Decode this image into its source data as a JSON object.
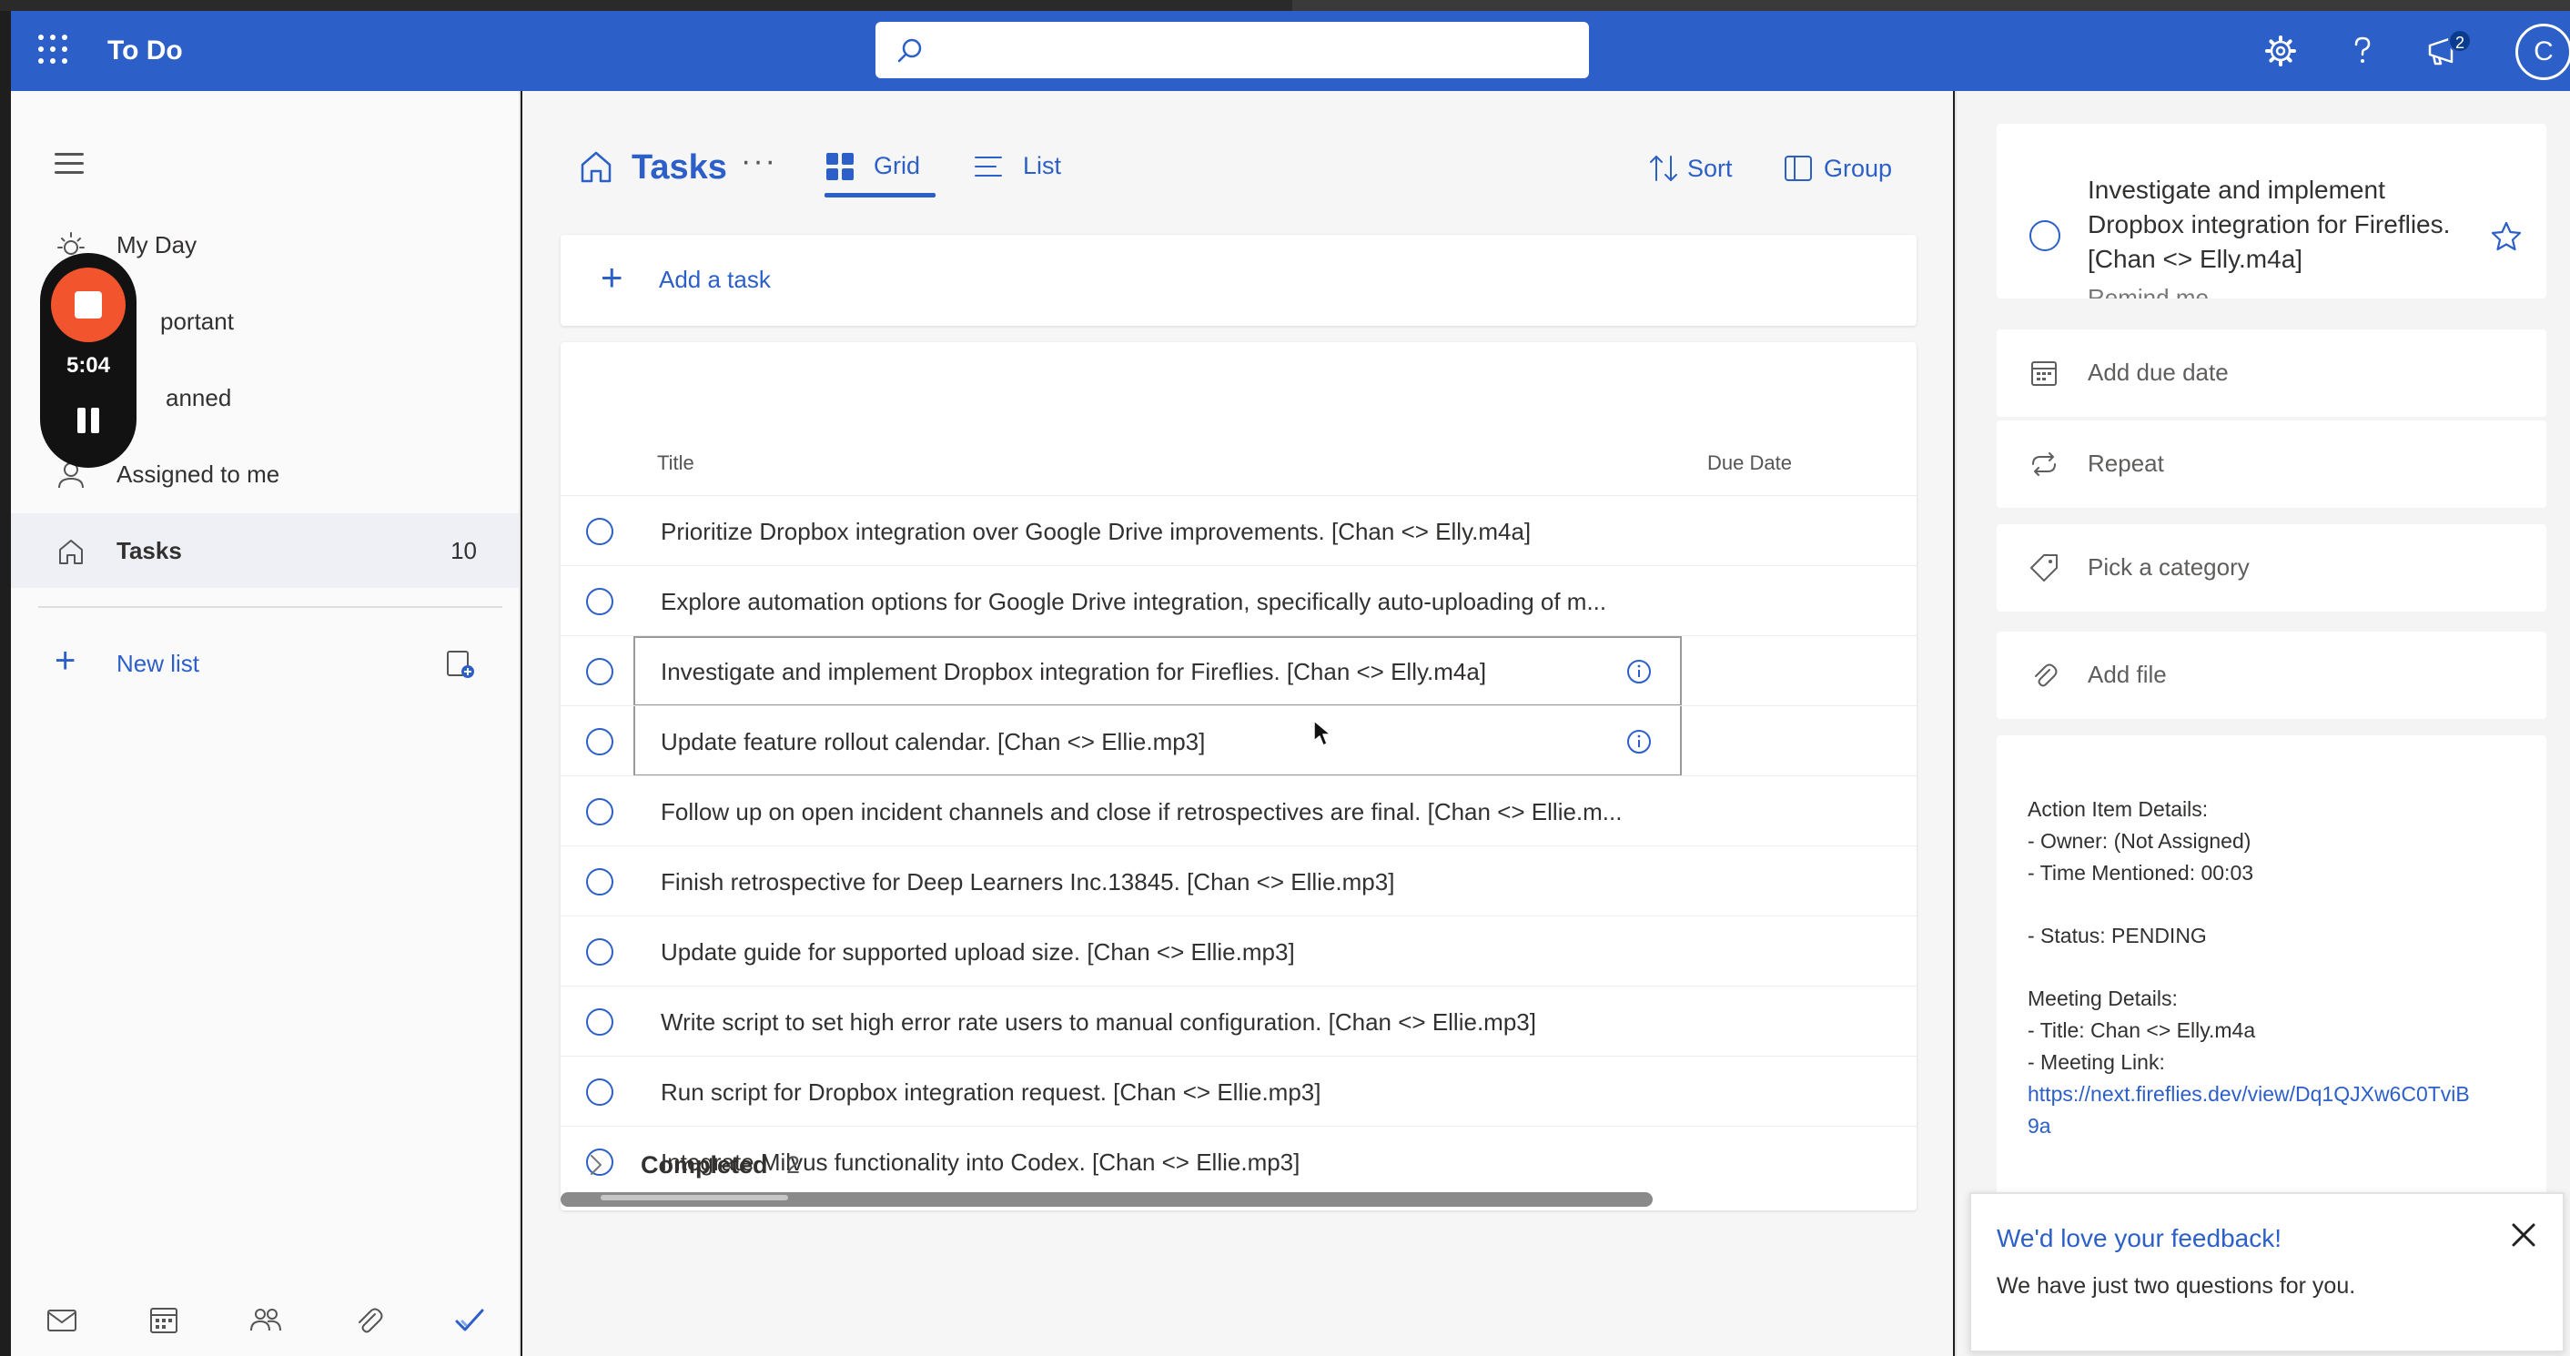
{
  "app": {
    "title": "To Do",
    "accent": "#2c5fc7"
  },
  "search": {
    "value": "",
    "placeholder": ""
  },
  "topbar": {
    "icons": [
      "waffle-icon",
      "search-icon",
      "settings-icon",
      "help-icon",
      "notifications-icon"
    ],
    "notification_count": "2",
    "avatar_initial": "C"
  },
  "sidebar": {
    "items": [
      {
        "label": "My Day",
        "icon": "sun-icon",
        "count": ""
      },
      {
        "label": "portant",
        "icon": "star-icon",
        "count": ""
      },
      {
        "label": "anned",
        "icon": "calendar-icon",
        "count": ""
      },
      {
        "label": "Assigned to me",
        "icon": "person-icon",
        "count": ""
      },
      {
        "label": "Tasks",
        "icon": "home-icon",
        "count": "10"
      }
    ],
    "new_list": "New list",
    "bottom_apps": [
      "mail-icon",
      "calendar-icon",
      "people-icon",
      "attachment-icon",
      "todo-check-icon"
    ]
  },
  "recorder": {
    "time": "5:04"
  },
  "main": {
    "title": "Tasks",
    "more": "···",
    "views": [
      {
        "label": "Grid",
        "active": true
      },
      {
        "label": "List",
        "active": false
      }
    ],
    "sort_label": "Sort",
    "group_label": "Group",
    "add_task": "Add a task",
    "columns": {
      "title": "Title",
      "due_date": "Due Date"
    },
    "tasks": [
      "Prioritize Dropbox integration over Google Drive improvements. [Chan <> Elly.m4a]",
      "Explore automation options for Google Drive integration, specifically auto-uploading of m...",
      "Investigate and implement Dropbox integration for Fireflies. [Chan <> Elly.m4a]",
      "Update feature rollout calendar. [Chan <> Ellie.mp3]",
      "Follow up on open incident channels and close if retrospectives are final. [Chan <> Ellie.m...",
      "Finish retrospective for Deep Learners Inc.13845. [Chan <> Ellie.mp3]",
      "Update guide for supported upload size. [Chan <> Ellie.mp3]",
      "Write script to set high error rate users to manual configuration. [Chan <> Ellie.mp3]",
      "Run script for Dropbox integration request. [Chan <> Ellie.mp3]",
      "Integrate Milvus functionality into Codex. [Chan <> Ellie.mp3]"
    ],
    "completed_label": "Completed",
    "completed_count": "2"
  },
  "detail": {
    "title": "Investigate and implement Dropbox integration for Fireflies. [Chan <> Elly.m4a]",
    "remind_me": "Remind me",
    "add_due_date": "Add due date",
    "repeat": "Repeat",
    "pick_category": "Pick a category",
    "add_file": "Add file",
    "notes": {
      "line1": "Action Item Details:",
      "line2": "- Owner: (Not Assigned)",
      "line3": "- Time Mentioned: 00:03",
      "line4": "- Status: PENDING",
      "line5": "Meeting Details:",
      "line6": "- Title: Chan <> Elly.m4a",
      "line7": "- Meeting Link:",
      "link_part1": "https://next.fireflies.dev/view/Dq1QJXw6C0TviB",
      "link_part2": "9a"
    }
  },
  "feedback": {
    "title": "We'd love your feedback!",
    "subtitle": "We have just two questions for you."
  }
}
